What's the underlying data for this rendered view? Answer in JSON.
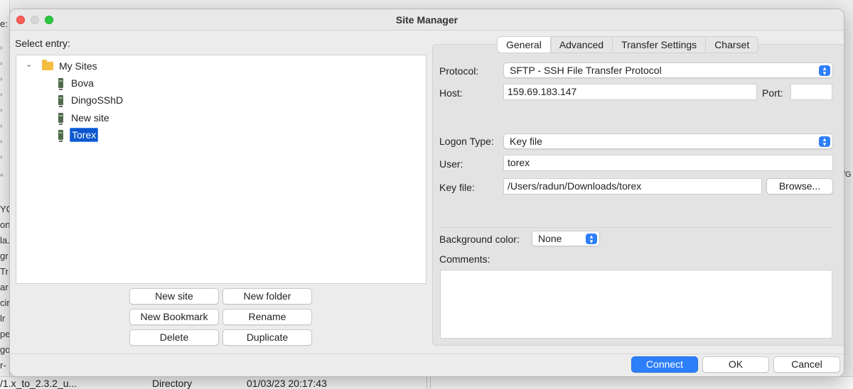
{
  "background": {
    "left_fragments": [
      "e:",
      "YC",
      "oni",
      "la.",
      "gr",
      "Tr",
      "ar",
      "cin",
      "lr",
      "pe",
      "go",
      "r-"
    ],
    "right_fragment": "/G",
    "bottom_row": {
      "name": "/1.x_to_2.3.2_u...",
      "type": "Directory",
      "date": "01/03/23 20:17:43"
    }
  },
  "dialog": {
    "title": "Site Manager",
    "select_entry_label": "Select entry:",
    "tree": {
      "root": "My Sites",
      "sites": [
        {
          "label": "Bova",
          "selected": false
        },
        {
          "label": "DingoSShD",
          "selected": false
        },
        {
          "label": "New site",
          "selected": false
        },
        {
          "label": "Torex",
          "selected": true
        }
      ]
    },
    "buttons": {
      "new_site": "New site",
      "new_folder": "New folder",
      "new_bookmark": "New Bookmark",
      "rename": "Rename",
      "delete": "Delete",
      "duplicate": "Duplicate"
    },
    "tabs": [
      {
        "label": "General",
        "active": true
      },
      {
        "label": "Advanced",
        "active": false
      },
      {
        "label": "Transfer Settings",
        "active": false
      },
      {
        "label": "Charset",
        "active": false
      }
    ],
    "general": {
      "protocol_label": "Protocol:",
      "protocol_value": "SFTP - SSH File Transfer Protocol",
      "host_label": "Host:",
      "host_value": "159.69.183.147",
      "port_label": "Port:",
      "port_value": "",
      "logon_type_label": "Logon Type:",
      "logon_type_value": "Key file",
      "user_label": "User:",
      "user_value": "torex",
      "key_file_label": "Key file:",
      "key_file_value": "/Users/radun/Downloads/torex",
      "browse_label": "Browse...",
      "background_color_label": "Background color:",
      "background_color_value": "None",
      "comments_label": "Comments:",
      "comments_value": ""
    },
    "footer": {
      "connect": "Connect",
      "ok": "OK",
      "cancel": "Cancel"
    }
  },
  "colors": {
    "accent": "#2d7ff9",
    "selection": "#0b57d0",
    "close": "#fe5f57",
    "maximize": "#28c840"
  }
}
